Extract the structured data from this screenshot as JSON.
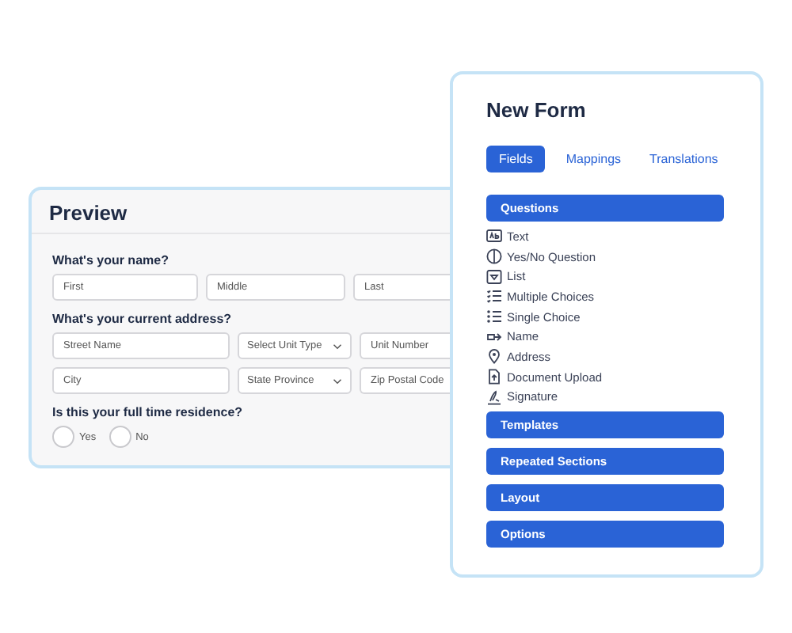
{
  "preview": {
    "title": "Preview",
    "questions": [
      {
        "label": "What's your name?",
        "rows": [
          [
            {
              "kind": "text",
              "placeholder": "First"
            },
            {
              "kind": "text",
              "placeholder": "Middle"
            },
            {
              "kind": "text",
              "placeholder": "Last"
            }
          ]
        ]
      },
      {
        "label": "What's your current address?",
        "rows": [
          [
            {
              "kind": "text",
              "placeholder": "Street Name"
            },
            {
              "kind": "select",
              "placeholder": "Select Unit Type"
            },
            {
              "kind": "text",
              "placeholder": "Unit Number"
            }
          ],
          [
            {
              "kind": "text",
              "placeholder": "City"
            },
            {
              "kind": "select",
              "placeholder": "State Province"
            },
            {
              "kind": "text",
              "placeholder": "Zip Postal Code"
            }
          ]
        ]
      },
      {
        "label": "Is this your full time residence?",
        "options": [
          {
            "label": "Yes",
            "selected": false
          },
          {
            "label": "No",
            "selected": false
          }
        ]
      }
    ]
  },
  "editor": {
    "title": "New Form",
    "tabs": [
      {
        "label": "Fields",
        "selected": true
      },
      {
        "label": "Mappings",
        "selected": false
      },
      {
        "label": "Translations",
        "selected": false
      }
    ],
    "sections": [
      {
        "label": "Questions",
        "items": [
          "Text",
          "Yes/No Question",
          "List",
          "Multiple Choices",
          "Single Choice",
          "Name",
          "Address",
          "Document Upload",
          "Signature"
        ]
      },
      {
        "label": "Templates"
      },
      {
        "label": "Repeated Sections"
      },
      {
        "label": "Layout"
      },
      {
        "label": "Options"
      }
    ]
  }
}
